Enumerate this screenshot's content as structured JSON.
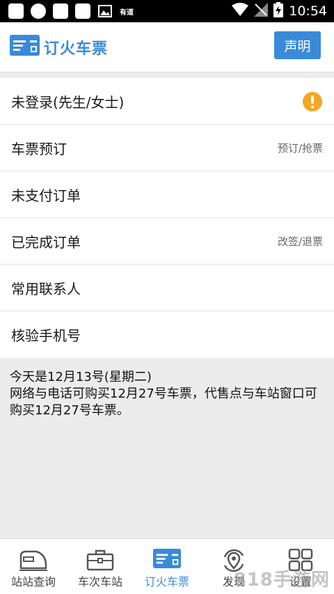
{
  "status_bar": {
    "app_label": "有道",
    "time": "10:54"
  },
  "header": {
    "title": "订火车票",
    "declare_label": "声明"
  },
  "menu": [
    {
      "label": "未登录(先生/女士)",
      "hint": ""
    },
    {
      "label": "车票预订",
      "hint": "预订/抢票"
    },
    {
      "label": "未支付订单",
      "hint": ""
    },
    {
      "label": "已完成订单",
      "hint": "改签/退票"
    },
    {
      "label": "常用联系人",
      "hint": ""
    },
    {
      "label": "核验手机号",
      "hint": ""
    }
  ],
  "info": {
    "line1": "今天是12月13号(星期二)",
    "line2": "网络与电话可购买12月27号车票，代售点与车站窗口可购买12月27号车票。"
  },
  "tabs": [
    {
      "label": "站站查询"
    },
    {
      "label": "车次车站"
    },
    {
      "label": "订火车票"
    },
    {
      "label": "发现"
    },
    {
      "label": "设置"
    }
  ],
  "watermark": "818手游网",
  "colors": {
    "accent": "#3a8ad9",
    "warning": "#f5a623"
  }
}
